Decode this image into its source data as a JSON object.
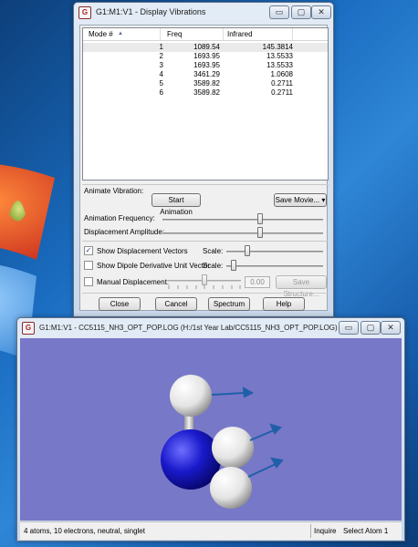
{
  "vibrations_window": {
    "title": "G1:M1:V1 - Display Vibrations",
    "window_controls": {
      "minimize": "▭",
      "maximize": "▢",
      "close": "✕"
    },
    "columns": [
      "Mode #",
      "Freq",
      "Infrared"
    ],
    "rows": [
      {
        "mode": "1",
        "freq": "1089.54",
        "infrared": "145.3814",
        "selected": true
      },
      {
        "mode": "2",
        "freq": "1693.95",
        "infrared": "13.5533",
        "selected": false
      },
      {
        "mode": "3",
        "freq": "1693.95",
        "infrared": "13.5533",
        "selected": false
      },
      {
        "mode": "4",
        "freq": "3461.29",
        "infrared": "1.0608",
        "selected": false
      },
      {
        "mode": "5",
        "freq": "3589.82",
        "infrared": "0.2711",
        "selected": false
      },
      {
        "mode": "6",
        "freq": "3589.82",
        "infrared": "0.2711",
        "selected": false
      }
    ],
    "animate_vibration_label": "Animate Vibration:",
    "start_animation_button": "Start Animation",
    "save_movie_button": "Save Movie...",
    "animation_frequency_label": "Animation Frequency:",
    "animation_frequency_level": 0.61,
    "displacement_amplitude_label": "Displacement Amplitude:",
    "displacement_amplitude_level": 0.61,
    "show_displacement_vectors": {
      "label": "Show Displacement Vectors",
      "checked": true,
      "scale_label": "Scale:",
      "scale_level": 0.2
    },
    "show_dipole_vector": {
      "label": "Show Dipole Derivative Unit Vector",
      "checked": false,
      "scale_label": "Scale:",
      "scale_level": 0.05
    },
    "manual_displacement": {
      "label": "Manual Displacement:",
      "checked": false,
      "value": "0.00",
      "level": 0.5
    },
    "save_structure_button": "Save Structure...",
    "buttons": {
      "close": "Close",
      "cancel": "Cancel",
      "spectrum": "Spectrum",
      "help": "Help"
    }
  },
  "molecule_window": {
    "title": "G1:M1:V1 - CC5115_NH3_OPT_POP.LOG (H:/1st Year Lab/CC5115_NH3_OPT_POP.LOG)",
    "window_controls": {
      "minimize": "▭",
      "maximize": "▢",
      "close": "✕"
    },
    "background_color": "#7878c8",
    "nitrogen_color": "#1a1acc",
    "hydrogen_color": "#f2f2f2",
    "vector_color": "#1e5fa8",
    "status_text": "4 atoms, 10 electrons, neutral, singlet",
    "status_mode": "Inquire",
    "status_action": "Select Atom 1"
  }
}
